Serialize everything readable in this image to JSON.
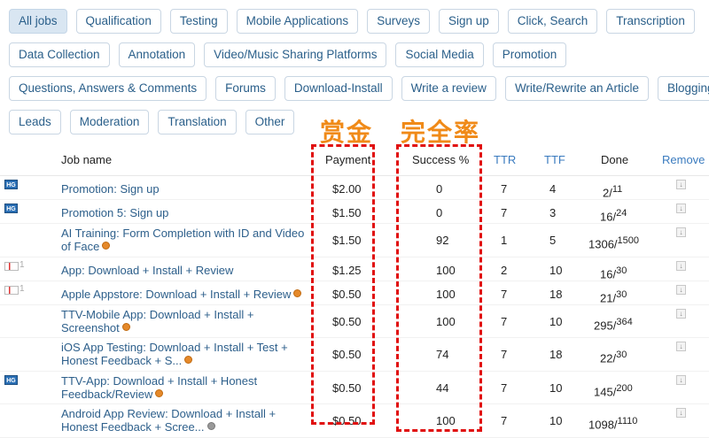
{
  "categories": [
    [
      "All jobs",
      "Qualification",
      "Testing",
      "Mobile Applications",
      "Surveys",
      "Sign up",
      "Click, Search",
      "Transcription"
    ],
    [
      "Data Collection",
      "Annotation",
      "Video/Music Sharing Platforms",
      "Social Media",
      "Promotion"
    ],
    [
      "Questions, Answers & Comments",
      "Forums",
      "Download-Install",
      "Write a review",
      "Write/Rewrite an Article",
      "Blogging"
    ],
    [
      "Leads",
      "Moderation",
      "Translation",
      "Other"
    ]
  ],
  "active_category": "All jobs",
  "annotations": {
    "payment_label": "赏金",
    "success_label": "完全率"
  },
  "headers": {
    "job": "Job name",
    "payment": "Payment",
    "success": "Success %",
    "ttr": "TTR",
    "ttf": "TTF",
    "done": "Done",
    "remove": "Remove"
  },
  "jobs": [
    {
      "icon": "hg",
      "lines": [
        "Promotion: Sign up"
      ],
      "dot": "",
      "payment": "$2.00",
      "success": "0",
      "ttr": "7",
      "ttf": "4",
      "done": "2",
      "total": "11"
    },
    {
      "icon": "hg",
      "lines": [
        "Promotion 5: Sign up"
      ],
      "dot": "",
      "payment": "$1.50",
      "success": "0",
      "ttr": "7",
      "ttf": "3",
      "done": "16",
      "total": "24"
    },
    {
      "icon": "",
      "lines": [
        "AI Training: Form Completion with ID and Video",
        "of Face"
      ],
      "dot": "orange",
      "payment": "$1.50",
      "success": "92",
      "ttr": "1",
      "ttf": "5",
      "done": "1306",
      "total": "1500"
    },
    {
      "icon": "flag",
      "lines": [
        "App: Download + Install + Review"
      ],
      "dot": "",
      "payment": "$1.25",
      "success": "100",
      "ttr": "2",
      "ttf": "10",
      "done": "16",
      "total": "30"
    },
    {
      "icon": "flag",
      "lines": [
        "Apple Appstore: Download + Install + Review"
      ],
      "dot": "orange",
      "payment": "$0.50",
      "success": "100",
      "ttr": "7",
      "ttf": "18",
      "done": "21",
      "total": "30"
    },
    {
      "icon": "",
      "lines": [
        "TTV-Mobile App: Download + Install +",
        "Screenshot"
      ],
      "dot": "orange",
      "payment": "$0.50",
      "success": "100",
      "ttr": "7",
      "ttf": "10",
      "done": "295",
      "total": "364"
    },
    {
      "icon": "",
      "lines": [
        "iOS App Testing: Download + Install + Test +",
        "Honest Feedback + S..."
      ],
      "dot": "orange",
      "payment": "$0.50",
      "success": "74",
      "ttr": "7",
      "ttf": "18",
      "done": "22",
      "total": "30"
    },
    {
      "icon": "hg",
      "lines": [
        "TTV-App: Download + Install + Honest",
        "Feedback/Review"
      ],
      "dot": "orange",
      "payment": "$0.50",
      "success": "44",
      "ttr": "7",
      "ttf": "10",
      "done": "145",
      "total": "200"
    },
    {
      "icon": "",
      "lines": [
        "Android App Review: Download + Install +",
        "Honest Feedback + Scree..."
      ],
      "dot": "gray",
      "payment": "$0.50",
      "success": "100",
      "ttr": "7",
      "ttf": "10",
      "done": "1098",
      "total": "1110"
    }
  ],
  "icon_text": {
    "hg": "HG",
    "flag_num": "1"
  },
  "colors": {
    "link": "#2d5f8b",
    "annotation": "#f08a18",
    "highlight_box": "#e10f0f"
  }
}
